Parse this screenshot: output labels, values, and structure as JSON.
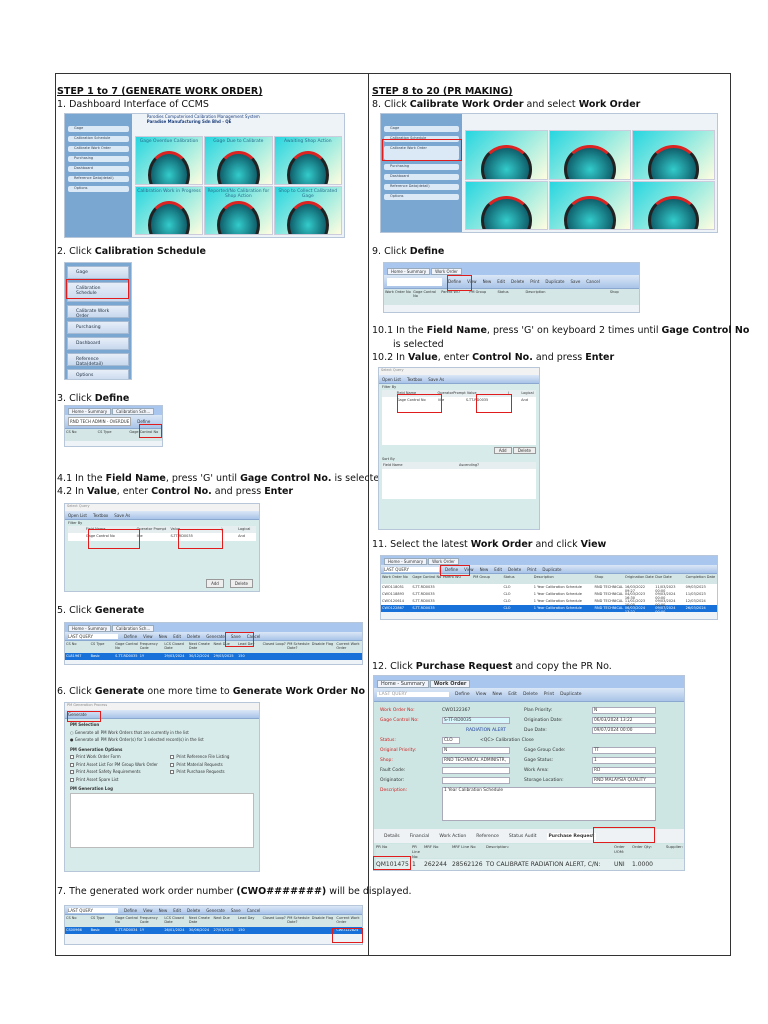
{
  "left": {
    "header": "STEP 1 to 7 (GENERATE WORK ORDER)",
    "steps": [
      {
        "num": "1.",
        "pre": " Dashboard Interface of CCMS"
      },
      {
        "num": "2.",
        "pre": " Click ",
        "b1": "Calibration Schedule"
      },
      {
        "num": "3.",
        "pre": " Click ",
        "b1": "Define"
      },
      {
        "num": "4.1",
        "pre": " In the ",
        "b1": "Field Name",
        ",mid": "",
        "mid1": ", press 'G' until ",
        "b2": "Gage Control No.",
        "post": " is selected"
      },
      {
        "num": "4.2",
        "pre": " In ",
        "b1": "Value",
        "mid1": ", enter ",
        "b2": "Control No.",
        "mid2": " and press ",
        "b3": "Enter"
      },
      {
        "num": "5.",
        "pre": " Click ",
        "b1": "Generate"
      },
      {
        "num": "6.",
        "pre": " Click ",
        "b1": "Generate",
        "mid1": " one more time to ",
        "b2": "Generate Work Order No"
      },
      {
        "num": "7.",
        "pre": " The generated work order number ",
        "b1": "(CWO#######)",
        "post": " will be displayed."
      }
    ]
  },
  "right": {
    "header": "STEP 8 to 20 (PR MAKING)",
    "steps": [
      {
        "num": "8.",
        "pre": " Click ",
        "b1": "Calibrate Work Order",
        "mid1": " and select ",
        "b2": "Work Order"
      },
      {
        "num": "9.",
        "pre": " Click ",
        "b1": "Define"
      },
      {
        "num": "10.1",
        "pre": " In the ",
        "b1": "Field Name",
        "mid1": ", press 'G' on keyboard 2 times until ",
        "b2": "Gage Control No",
        "post": "is selected"
      },
      {
        "num": "10.2",
        "pre": " In ",
        "b1": "Value",
        "mid1": ", enter ",
        "b2": "Control No.",
        "mid2": " and press ",
        "b3": "Enter"
      },
      {
        "num": "11.",
        "pre": " Select the latest ",
        "b1": "Work Order",
        "mid1": " and click ",
        "b2": "View"
      },
      {
        "num": "12.",
        "pre": " Click ",
        "b1": "Purchase Request",
        "mid1": " and copy the PR No."
      }
    ]
  },
  "app": {
    "system_title": "Parodies Computerised Calibration Management System",
    "company": "Paradise Manufacturing Sdn Bhd - QE",
    "menu": [
      "Gage",
      "Calibration Schedule",
      "Calibrate Work Order",
      "Purchasing",
      "Dashboard",
      "Reference Data(detail)",
      "Options"
    ],
    "submenu": "Calibration Schedule",
    "gauges": [
      "Gage Overdue Calibration",
      "Gage Due to Calibrate",
      "Awaiting Shop Action",
      "Calibration Work in Progress",
      "Reported/No Calibration for Shop Action",
      "Shop to Collect Calibrated Gage"
    ],
    "tabs": {
      "home": "Home - Summary",
      "cal": "Calibration Sch...",
      "wo": "Work Order"
    },
    "toolbar": [
      "Define",
      "View",
      "New",
      "Edit",
      "Delete",
      "Generate",
      "Save",
      "Cancel"
    ],
    "wo_toolbar": [
      "Define",
      "View",
      "New",
      "Edit",
      "Delete",
      "Print",
      "Duplicate",
      "Save",
      "Cancel"
    ],
    "query": "LAST QUERY",
    "query3": "RND TECH ADMIN - OVERDUE",
    "cs_headers": [
      "CS No",
      "CS Type",
      "Gage Control No",
      "Frequency Code",
      "LCS Closed Date",
      "Next Create Date",
      "Next Due",
      "Lead Day",
      "Closed Loop?",
      "PM Schedule Date?",
      "Disable Flag",
      "Current Work Order"
    ],
    "cs_row5": [
      "CL81967",
      "Basic",
      "S-TT-RD0035",
      "1Y",
      "29/03/2024",
      "30/12/2024",
      "29/03/2025",
      "150"
    ],
    "cs_row7": [
      "CS00966",
      "Basic",
      "S-TT-RD0034",
      "1Y",
      "26/01/2024",
      "30/06/2024",
      "27/01/2025",
      "150",
      "CWO122824"
    ],
    "select_query": {
      "title": "Select Query",
      "buttons": [
        "Open List",
        "Textbox",
        "Save As"
      ],
      "filter": "Filter By",
      "cols": [
        "Field Name",
        "Operator",
        "Prompt",
        "Value",
        ")",
        "Logical"
      ],
      "field": "Gage Control No",
      "op": "like",
      "value": "S-TT-RD0035",
      "logical": "And",
      "add": "Add",
      "delete": "Delete",
      "sort": "Sort By",
      "sort_cols": [
        "Field Name",
        "Ascending?"
      ]
    },
    "pm": {
      "title": "PM Generation Process",
      "generate": "Generate",
      "selection": "PM Selection",
      "opt1": "Generate all PM Work Orders that are currently in the list",
      "opt2": "Generate all PM Work Order(s) for 1 selected record(s) in the list",
      "options_title": "PM Generation Options",
      "options": [
        "Print Work Order Form",
        "Print Asset List For PM Group Work Order",
        "Print Asset Safety Requirements",
        "Print Asset Spare List",
        "Print Reference File Listing",
        "Print Material Requests",
        "Print Purchase Requests"
      ],
      "log": "PM Generation Log"
    },
    "wo_headers": [
      "Work Order No",
      "Gage Control No",
      "Parent WO",
      "PM Group",
      "Status",
      "Description",
      "Shop"
    ],
    "wo_list": {
      "headers": [
        "Work Order No",
        "Gage Control No",
        "Parent WO",
        "PM Group",
        "Status",
        "Description",
        "Shop",
        "Origination Date",
        "Due Date",
        "Completion Date"
      ],
      "rows": [
        [
          "CWO118051",
          "S-TT-RD0035",
          "",
          "",
          "CLO",
          "1 Year Calibration Schedule",
          "RND TECHNICAL",
          "16/03/2022 09:27",
          "11/03/2023 00:00",
          "09/03/2023"
        ],
        [
          "CWO118893",
          "S-TT-RD0035",
          "",
          "",
          "CLO",
          "1 Year Calibration Schedule",
          "RND TECHNICAL",
          "04/03/2023 16:30",
          "09/03/2024 00:00",
          "11/03/2023"
        ],
        [
          "CWO120614",
          "S-TT-RD0035",
          "",
          "",
          "CLO",
          "1 Year Calibration Schedule",
          "RND TECHNICAL",
          "11/01/2023 10:05",
          "09/03/2024 00:00",
          "12/03/2024"
        ],
        [
          "CWO122867",
          "S-TT-RD0035",
          "",
          "",
          "CLO",
          "1 Year Calibration Schedule",
          "RND TECHNICAL",
          "06/03/2024 13:22",
          "09/07/2024 00:00",
          "26/03/2024"
        ]
      ]
    },
    "wo_form": {
      "wo_no_label": "Work Order No:",
      "wo_no": "CWO122367",
      "gage_label": "Gage Control No:",
      "gage": "S-TT-RD0035",
      "gage_desc": "RADIATION ALERT",
      "status_label": "Status:",
      "status": "CLO",
      "status_desc": "<QC> Calibration Close",
      "orig_pri_label": "Original Priority:",
      "orig_pri": "N",
      "shop_label": "Shop:",
      "shop": "RND TECHNICAL ADMINISTR,",
      "fault_label": "Fault Code:",
      "originator_label": "Originator:",
      "desc_label": "Description:",
      "desc": "1 Year Calibration Schedule",
      "plan_label": "Plan Priority:",
      "plan": "N",
      "origdate_label": "Origination Date:",
      "origdate": "06/03/2024 13:22",
      "due_label": "Due Date:",
      "due": "09/07/2024 00:00",
      "group_label": "Gage Group Code:",
      "group": "TT",
      "gstatus_label": "Gage Status:",
      "gstatus": "1",
      "area_label": "Work Area:",
      "area": "RD",
      "storage_label": "Storage Location:",
      "storage": "RND MALAYSIA QUALITY",
      "subtabs": [
        "Details",
        "Financial",
        "Work Action",
        "Reference",
        "Status Audit",
        "Purchase Request"
      ],
      "pr_headers": [
        "PR No",
        "PR Line No:",
        "MRF No",
        "MRF Line No",
        "Description:",
        "Order UOM:",
        "Order Qty:",
        "Supplier:"
      ],
      "pr_row": [
        "QM101475",
        "1",
        "262244",
        "28562126",
        "TO CALIBRATE RADIATION ALERT, C/N:",
        "UNI",
        "1.0000",
        ""
      ]
    }
  },
  "colors": {
    "highlight": "#e01c1c",
    "selected_row": "#1871d8",
    "form_bg": "#cde6e3"
  }
}
